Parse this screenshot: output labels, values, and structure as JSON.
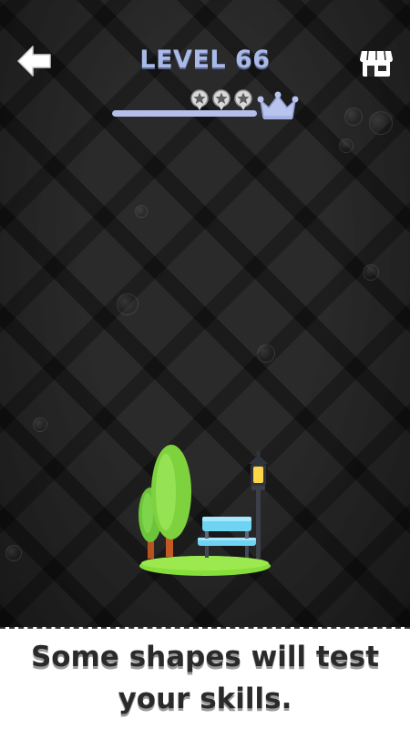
{
  "header": {
    "level_title": "LEVEL 66",
    "back_icon": "arrow-left-icon",
    "shop_icon": "shop-icon"
  },
  "progress": {
    "fill_fraction": 0.96,
    "stars_total": 3,
    "stars_icon": "star-icon",
    "goal_icon": "crown-icon",
    "track_color": "#2c2f3b",
    "fill_color": "#b4c0ea",
    "crown_color": "#b8c4ee"
  },
  "scene": {
    "name": "park scene with trees, bench and lamp post",
    "tree_color": "#7ed23e",
    "bench_color": "#6fd3f2",
    "grass_color": "#86de3a",
    "lamp_glow_color": "#ffd54a"
  },
  "caption": {
    "text": "Some shapes will test your skills."
  }
}
